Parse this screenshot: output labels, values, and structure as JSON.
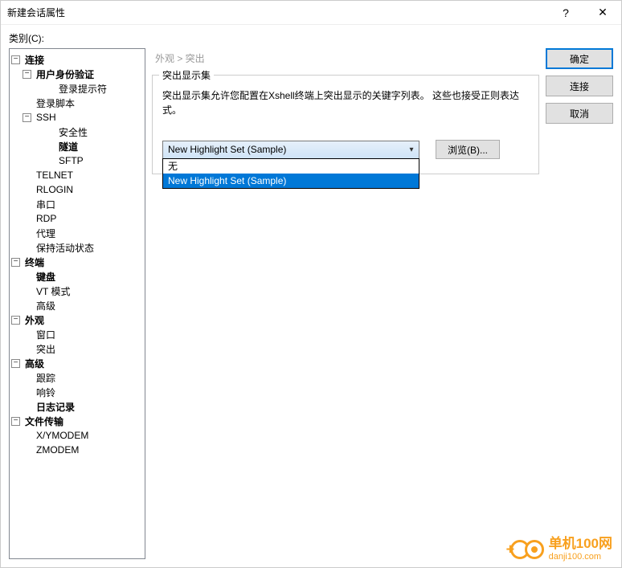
{
  "window": {
    "title": "新建会话属性"
  },
  "category_label": "类别(C):",
  "tree": {
    "connection": "连接",
    "auth": "用户身份验证",
    "login_prompt": "登录提示符",
    "login_script": "登录脚本",
    "ssh": "SSH",
    "security": "安全性",
    "tunnel": "隧道",
    "sftp": "SFTP",
    "telnet": "TELNET",
    "rlogin": "RLOGIN",
    "serial": "串口",
    "rdp": "RDP",
    "proxy": "代理",
    "keepalive": "保持活动状态",
    "terminal": "终端",
    "keyboard": "键盘",
    "vtmode": "VT 模式",
    "advanced1": "高级",
    "appearance": "外观",
    "window_item": "窗口",
    "highlight": "突出",
    "advanced2": "高级",
    "trace": "跟踪",
    "bell": "响铃",
    "logging": "日志记录",
    "filetransfer": "文件传输",
    "xymodem": "X/YMODEM",
    "zmodem": "ZMODEM"
  },
  "breadcrumb": "外观 > 突出",
  "fieldset": {
    "legend": "突出显示集",
    "desc": "突出显示集允许您配置在Xshell终端上突出显示的关键字列表。 这些也接受正则表达式。",
    "selected": "New Highlight Set (Sample)",
    "options": [
      "无",
      "New Highlight Set (Sample)"
    ],
    "browse": "浏览(B)..."
  },
  "buttons": {
    "ok": "确定",
    "connect": "连接",
    "cancel": "取消"
  },
  "watermark": {
    "line1": "单机100网",
    "line2": "danji100.com"
  }
}
